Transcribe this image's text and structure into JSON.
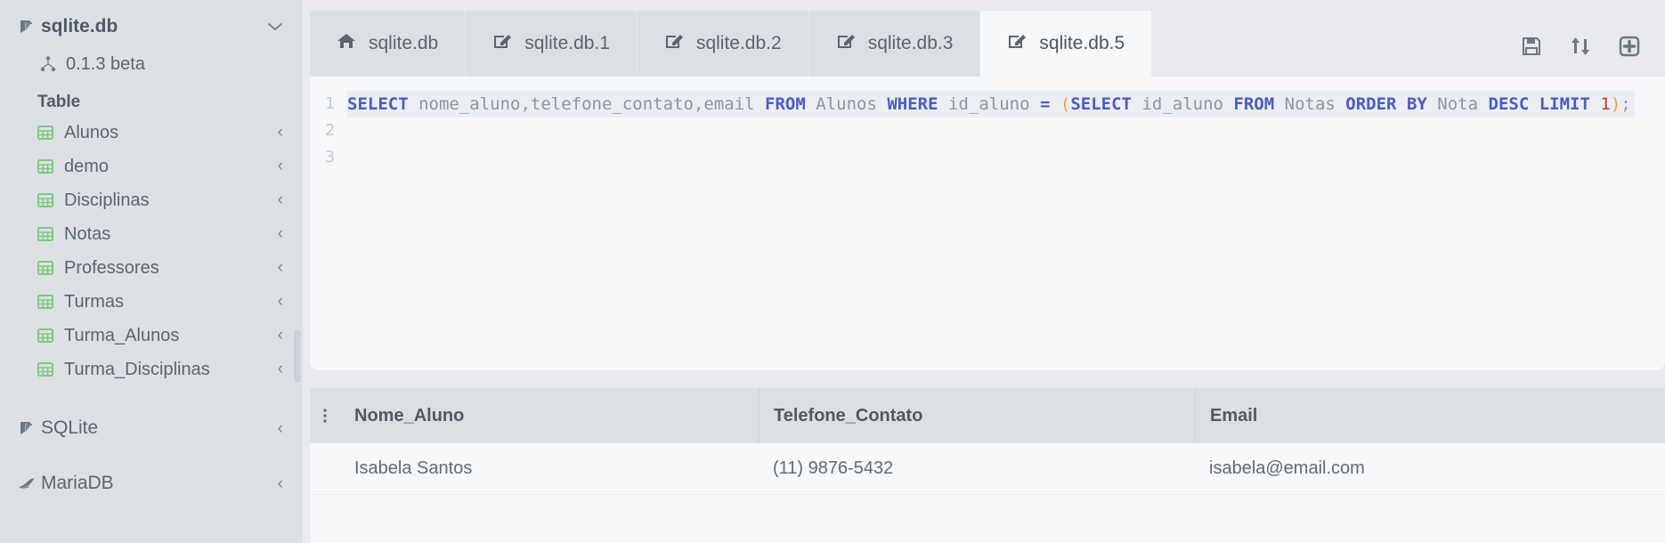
{
  "sidebar": {
    "database": {
      "label": "sqlite.db",
      "icon": "database-book-icon",
      "chevron": "chevron-down-icon"
    },
    "version": {
      "label": "0.1.3 beta",
      "icon": "sitemap-icon"
    },
    "section_label": "Table",
    "tables": [
      {
        "label": "Alunos",
        "icon": "table-icon",
        "chevron": "chevron-left-icon"
      },
      {
        "label": "demo",
        "icon": "table-icon",
        "chevron": "chevron-left-icon"
      },
      {
        "label": "Disciplinas",
        "icon": "table-icon",
        "chevron": "chevron-left-icon"
      },
      {
        "label": "Notas",
        "icon": "table-icon",
        "chevron": "chevron-left-icon"
      },
      {
        "label": "Professores",
        "icon": "table-icon",
        "chevron": "chevron-left-icon"
      },
      {
        "label": "Turmas",
        "icon": "table-icon",
        "chevron": "chevron-left-icon"
      },
      {
        "label": "Turma_Alunos",
        "icon": "table-icon",
        "chevron": "chevron-left-icon"
      },
      {
        "label": "Turma_Disciplinas",
        "icon": "table-icon",
        "chevron": "chevron-left-icon"
      }
    ],
    "connections": [
      {
        "label": "SQLite",
        "icon": "database-book-icon",
        "chevron": "chevron-left-icon"
      },
      {
        "label": "MariaDB",
        "icon": "mariadb-seal-icon",
        "chevron": "chevron-left-icon"
      }
    ]
  },
  "tabs": [
    {
      "label": "sqlite.db",
      "icon": "home-icon",
      "active": false
    },
    {
      "label": "sqlite.db.1",
      "icon": "edit-square-icon",
      "active": false
    },
    {
      "label": "sqlite.db.2",
      "icon": "edit-square-icon",
      "active": false
    },
    {
      "label": "sqlite.db.3",
      "icon": "edit-square-icon",
      "active": false
    },
    {
      "label": "sqlite.db.5",
      "icon": "edit-square-icon",
      "active": true
    }
  ],
  "toolbar": {
    "save": {
      "label": "Save",
      "icon": "floppy-save-icon"
    },
    "sync": {
      "label": "Sync",
      "icon": "exchange-arrows-icon"
    },
    "add": {
      "label": "Add",
      "icon": "plus-square-icon"
    }
  },
  "editor": {
    "line_numbers": [
      "1",
      "2",
      "3"
    ],
    "query_text": "SELECT nome_aluno,telefone_contato,email FROM Alunos WHERE id_aluno = (SELECT id_aluno FROM Notas ORDER BY Nota DESC LIMIT 1);",
    "tokens": [
      {
        "t": "SELECT",
        "k": "kw"
      },
      {
        "t": " ",
        "k": "id"
      },
      {
        "t": "nome_aluno,telefone_contato,email",
        "k": "id"
      },
      {
        "t": " ",
        "k": "id"
      },
      {
        "t": "FROM",
        "k": "kw"
      },
      {
        "t": " ",
        "k": "id"
      },
      {
        "t": "Alunos",
        "k": "id"
      },
      {
        "t": " ",
        "k": "id"
      },
      {
        "t": "WHERE",
        "k": "kw"
      },
      {
        "t": " ",
        "k": "id"
      },
      {
        "t": "id_aluno",
        "k": "id"
      },
      {
        "t": " ",
        "k": "id"
      },
      {
        "t": "=",
        "k": "op"
      },
      {
        "t": " ",
        "k": "id"
      },
      {
        "t": "(",
        "k": "paren"
      },
      {
        "t": "SELECT",
        "k": "kw"
      },
      {
        "t": " ",
        "k": "id"
      },
      {
        "t": "id_aluno",
        "k": "id"
      },
      {
        "t": " ",
        "k": "id"
      },
      {
        "t": "FROM",
        "k": "kw"
      },
      {
        "t": " ",
        "k": "id"
      },
      {
        "t": "Notas",
        "k": "id"
      },
      {
        "t": " ",
        "k": "id"
      },
      {
        "t": "ORDER",
        "k": "kw"
      },
      {
        "t": " ",
        "k": "id"
      },
      {
        "t": "BY",
        "k": "kw"
      },
      {
        "t": " ",
        "k": "id"
      },
      {
        "t": "Nota",
        "k": "id"
      },
      {
        "t": " ",
        "k": "id"
      },
      {
        "t": "DESC",
        "k": "kw"
      },
      {
        "t": " ",
        "k": "id"
      },
      {
        "t": "LIMIT",
        "k": "kw"
      },
      {
        "t": " ",
        "k": "id"
      },
      {
        "t": "1",
        "k": "num"
      },
      {
        "t": ")",
        "k": "paren"
      },
      {
        "t": ";",
        "k": "semi"
      }
    ]
  },
  "results": {
    "row_menu_icon": "kebab-menu-icon",
    "columns": [
      "Nome_Aluno",
      "Telefone_Contato",
      "Email"
    ],
    "rows": [
      {
        "nome_aluno": "Isabela Santos",
        "telefone_contato": "(11) 9876-5432",
        "email": "isabela@email.com"
      }
    ]
  },
  "colors": {
    "sidebar_bg": "#dde1e6",
    "main_bg": "#e8eaed",
    "panel_bg": "#f7f8fa",
    "tab_inactive_bg": "#dcdfe3",
    "table_icon_green": "#7ec97e",
    "keyword_blue": "#4a5cc4",
    "identifier_grey": "#8e959e",
    "paren_orange": "#e8a33d",
    "number_red": "#c0392b",
    "text_grey": "#5b6570"
  }
}
